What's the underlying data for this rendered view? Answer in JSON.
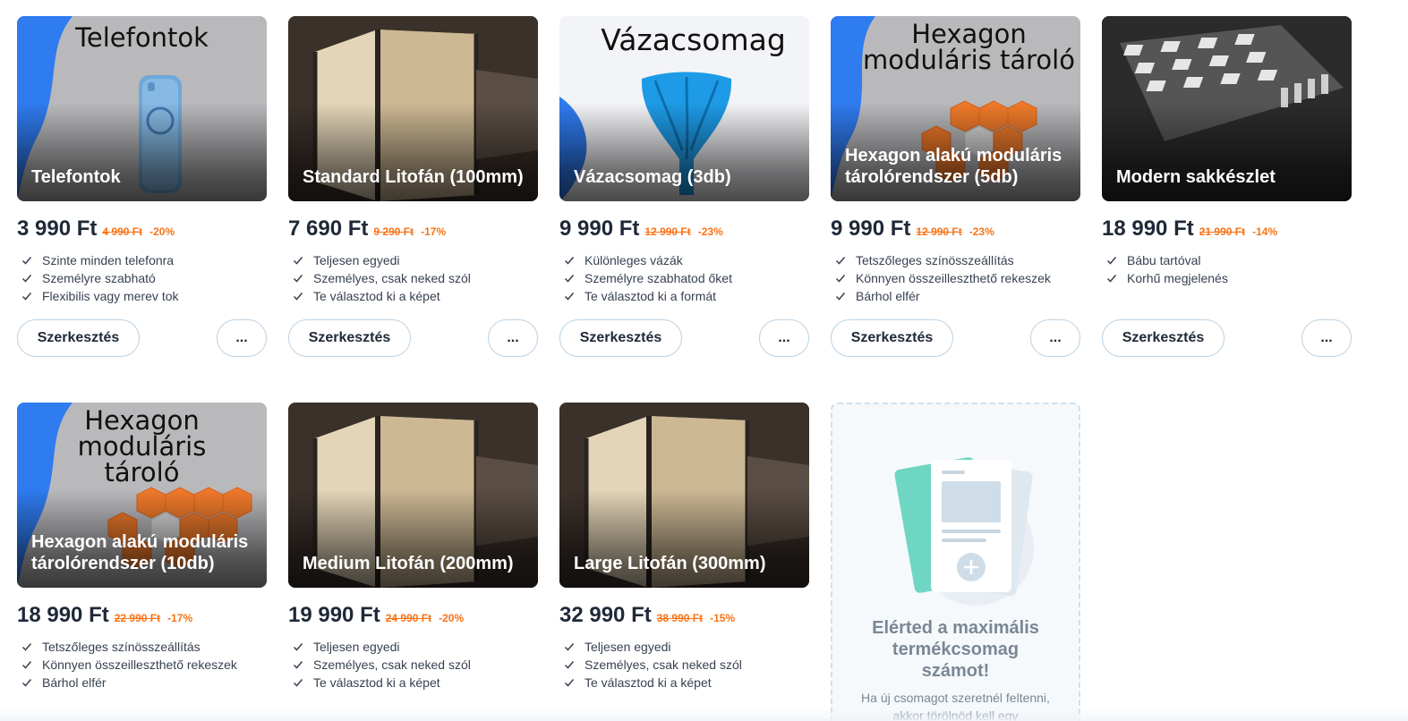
{
  "products": [
    {
      "headline": "Telefontok",
      "title": "Telefontok",
      "price": "3 990 Ft",
      "old_price": "4 990 Ft",
      "discount": "-20%",
      "features": [
        "Szinte minden telefonra",
        "Személyre szabható",
        "Flexibilis vagy merev tok"
      ],
      "edit_label": "Szerkesztés",
      "more_label": "...",
      "image": "phone-case-image"
    },
    {
      "headline": "",
      "title": "Standard Litofán (100mm)",
      "price": "7 690 Ft",
      "old_price": "9 290 Ft",
      "discount": "-17%",
      "features": [
        "Teljesen egyedi",
        "Személyes, csak neked szól",
        "Te választod ki a képet"
      ],
      "edit_label": "Szerkesztés",
      "more_label": "...",
      "image": "lithophane-cube-image"
    },
    {
      "headline": "Vázacsomag",
      "title": "Vázacsomag (3db)",
      "price": "9 990 Ft",
      "old_price": "12 990 Ft",
      "discount": "-23%",
      "features": [
        "Különleges vázák",
        "Személyre szabhatod őket",
        "Te választod ki a formát"
      ],
      "edit_label": "Szerkesztés",
      "more_label": "...",
      "image": "vase-image"
    },
    {
      "headline": "Hexagon moduláris tároló",
      "title": "Hexagon alakú moduláris tárolórendszer (5db)",
      "price": "9 990 Ft",
      "old_price": "12 990 Ft",
      "discount": "-23%",
      "features": [
        "Tetszőleges színösszeállítás",
        "Könnyen összeilleszthető rekeszek",
        "Bárhol elfér"
      ],
      "edit_label": "Szerkesztés",
      "more_label": "...",
      "image": "hexagon-storage-image"
    },
    {
      "headline": "",
      "title": "Modern sakkészlet",
      "price": "18 990 Ft",
      "old_price": "21 990 Ft",
      "discount": "-14%",
      "features": [
        "Bábu tartóval",
        "Korhű megjelenés"
      ],
      "edit_label": "Szerkesztés",
      "more_label": "...",
      "image": "chess-set-image"
    },
    {
      "headline": "Hexagon moduláris tároló",
      "title": "Hexagon alakú moduláris tárolórendszer (10db)",
      "price": "18 990 Ft",
      "old_price": "22 990 Ft",
      "discount": "-17%",
      "features": [
        "Tetszőleges színösszeállítás",
        "Könnyen összeilleszthető rekeszek",
        "Bárhol elfér"
      ],
      "edit_label": "Szerkesztés",
      "more_label": "...",
      "image": "hexagon-storage-image"
    },
    {
      "headline": "",
      "title": "Medium Litofán (200mm)",
      "price": "19 990 Ft",
      "old_price": "24 990 Ft",
      "discount": "-20%",
      "features": [
        "Teljesen egyedi",
        "Személyes, csak neked szól",
        "Te választod ki a képet"
      ],
      "edit_label": "Szerkesztés",
      "more_label": "...",
      "image": "lithophane-cube-image"
    },
    {
      "headline": "",
      "title": "Large Litofán (300mm)",
      "price": "32 990 Ft",
      "old_price": "38 990 Ft",
      "discount": "-15%",
      "features": [
        "Teljesen egyedi",
        "Személyes, csak neked szól",
        "Te választod ki a képet"
      ],
      "edit_label": "Szerkesztés",
      "more_label": "...",
      "image": "lithophane-cube-image"
    }
  ],
  "limit_card": {
    "title": "Elérted a maximális termékcsomag számot!",
    "text": "Ha új csomagot szeretnél feltenni, akkor törölnöd kell egy",
    "icon": "document-stack-icon"
  },
  "colors": {
    "accent_blue": "#2f7bf0",
    "discount_orange": "#f97316",
    "text_dark": "#1f2937",
    "button_border": "#bcd2e3"
  }
}
